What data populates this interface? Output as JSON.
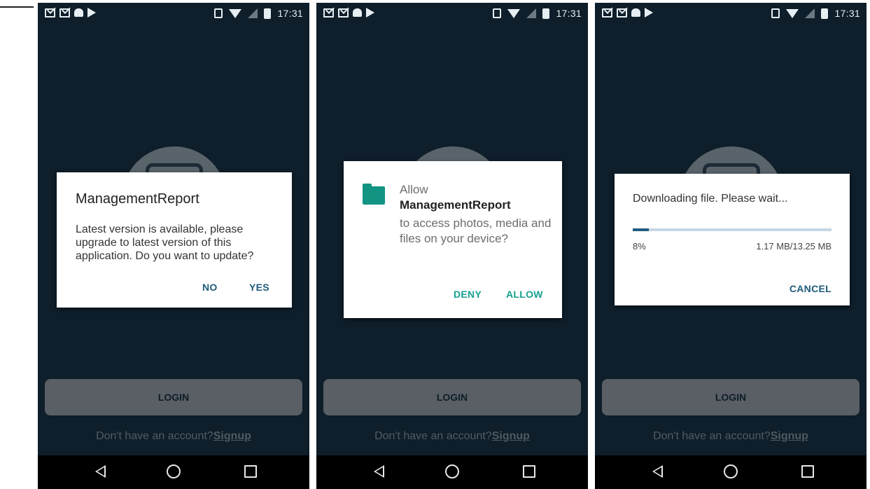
{
  "status_bar": {
    "time": "17:31"
  },
  "login_screen": {
    "login_label": "LOGIN",
    "signup_prompt": "Don't have an account?",
    "signup_link": "Signup"
  },
  "update_dialog": {
    "title": "ManagementReport",
    "message": "Latest version is available, please upgrade to latest version of this application. Do you want to update?",
    "no_label": "NO",
    "yes_label": "YES"
  },
  "permission_dialog": {
    "prefix": "Allow",
    "app_name": "ManagementReport",
    "message": "to access photos, media and files on your device?",
    "deny_label": "DENY",
    "allow_label": "ALLOW"
  },
  "download_dialog": {
    "message": "Downloading file. Please wait...",
    "progress_fraction": 0.08,
    "percent_label": "8%",
    "size_label": "1.17 MB/13.25 MB",
    "cancel_label": "CANCEL"
  },
  "colors": {
    "screen_background": "#0e1e2a",
    "primary_action": "#1f5b7b",
    "permission_accent": "#16a08e",
    "progress_fill": "#235d82"
  },
  "icons": [
    "gmail-icon",
    "android-icon",
    "play-store-icon",
    "vibrate-icon",
    "wifi-icon",
    "no-signal-icon",
    "battery-charging-icon",
    "back-icon",
    "home-icon",
    "recents-icon",
    "folder-icon"
  ]
}
